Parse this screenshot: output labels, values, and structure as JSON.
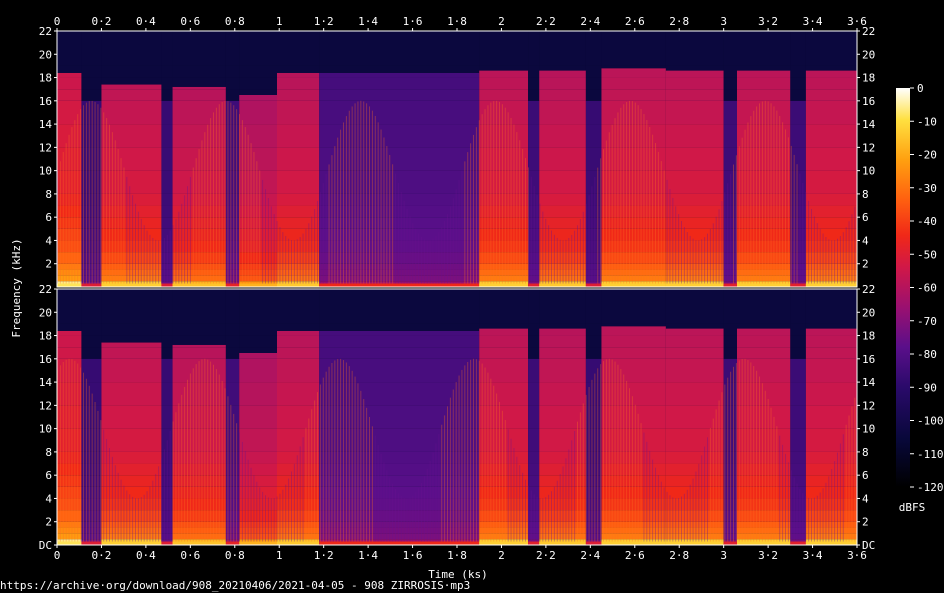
{
  "chart_data": {
    "type": "heatmap",
    "xlabel": "Time (ks)",
    "ylabel": "Frequency (kHz)",
    "colorbar_label": "dBFS",
    "x_ticks": [
      "0",
      "0·2",
      "0·4",
      "0·6",
      "0·8",
      "1",
      "1·2",
      "1·4",
      "1·6",
      "1·8",
      "2",
      "2·2",
      "2·4",
      "2·6",
      "2·8",
      "3",
      "3·2",
      "3·4",
      "3·6"
    ],
    "x_tick_values": [
      0,
      0.2,
      0.4,
      0.6,
      0.8,
      1,
      1.2,
      1.4,
      1.6,
      1.8,
      2,
      2.2,
      2.4,
      2.6,
      2.8,
      3,
      3.2,
      3.4,
      3.6
    ],
    "xlim": [
      0,
      3.6
    ],
    "y_ticks_top": [
      "22",
      "20",
      "18",
      "16",
      "14",
      "12",
      "10",
      "8",
      "6",
      "4",
      "2"
    ],
    "y_ticks_bottom": [
      "22",
      "20",
      "18",
      "16",
      "14",
      "12",
      "10",
      "8",
      "6",
      "4",
      "2",
      "DC"
    ],
    "y_tick_values": [
      22,
      20,
      18,
      16,
      14,
      12,
      10,
      8,
      6,
      4,
      2,
      0
    ],
    "ylim": [
      0,
      22
    ],
    "colorbar_ticks": [
      "0",
      "-10",
      "-20",
      "-30",
      "-40",
      "-50",
      "-60",
      "-70",
      "-80",
      "-90",
      "-100",
      "-110",
      "-120"
    ],
    "colorbar_values": [
      0,
      -10,
      -20,
      -30,
      -40,
      -50,
      -60,
      -70,
      -80,
      -90,
      -100,
      -110,
      -120
    ],
    "zlim": [
      -120,
      0
    ],
    "channels": 2,
    "segments": [
      {
        "t0": 0.0,
        "t1": 0.11,
        "level": 1.0,
        "cutoff": 18.4
      },
      {
        "t0": 0.11,
        "t1": 0.2,
        "level": 0.25,
        "cutoff": 16.0
      },
      {
        "t0": 0.2,
        "t1": 0.47,
        "level": 0.92,
        "cutoff": 17.4
      },
      {
        "t0": 0.47,
        "t1": 0.52,
        "level": 0.25,
        "cutoff": 16.0
      },
      {
        "t0": 0.52,
        "t1": 0.76,
        "level": 0.88,
        "cutoff": 17.2
      },
      {
        "t0": 0.76,
        "t1": 0.82,
        "level": 0.3,
        "cutoff": 16.0
      },
      {
        "t0": 0.82,
        "t1": 0.99,
        "level": 0.82,
        "cutoff": 16.5
      },
      {
        "t0": 0.99,
        "t1": 1.18,
        "level": 0.9,
        "cutoff": 18.4
      },
      {
        "t0": 1.18,
        "t1": 1.9,
        "level": 0.35,
        "cutoff": 18.4
      },
      {
        "t0": 1.9,
        "t1": 2.12,
        "level": 0.92,
        "cutoff": 18.6
      },
      {
        "t0": 2.12,
        "t1": 2.17,
        "level": 0.28,
        "cutoff": 16.0
      },
      {
        "t0": 2.17,
        "t1": 2.38,
        "level": 0.9,
        "cutoff": 18.6
      },
      {
        "t0": 2.38,
        "t1": 2.45,
        "level": 0.25,
        "cutoff": 16.0
      },
      {
        "t0": 2.45,
        "t1": 2.74,
        "level": 0.92,
        "cutoff": 18.8
      },
      {
        "t0": 2.74,
        "t1": 3.0,
        "level": 0.92,
        "cutoff": 18.6
      },
      {
        "t0": 3.0,
        "t1": 3.06,
        "level": 0.28,
        "cutoff": 16.0
      },
      {
        "t0": 3.06,
        "t1": 3.3,
        "level": 0.92,
        "cutoff": 18.6
      },
      {
        "t0": 3.3,
        "t1": 3.37,
        "level": 0.28,
        "cutoff": 16.0
      },
      {
        "t0": 3.37,
        "t1": 3.6,
        "level": 0.92,
        "cutoff": 18.6
      }
    ]
  },
  "source_url": "https://archive·org/download/908_20210406/2021-04-05 - 908 ZIRROSIS·mp3",
  "colors": {
    "background": "#000000",
    "silence": "#080833",
    "text": "#ffffff"
  }
}
